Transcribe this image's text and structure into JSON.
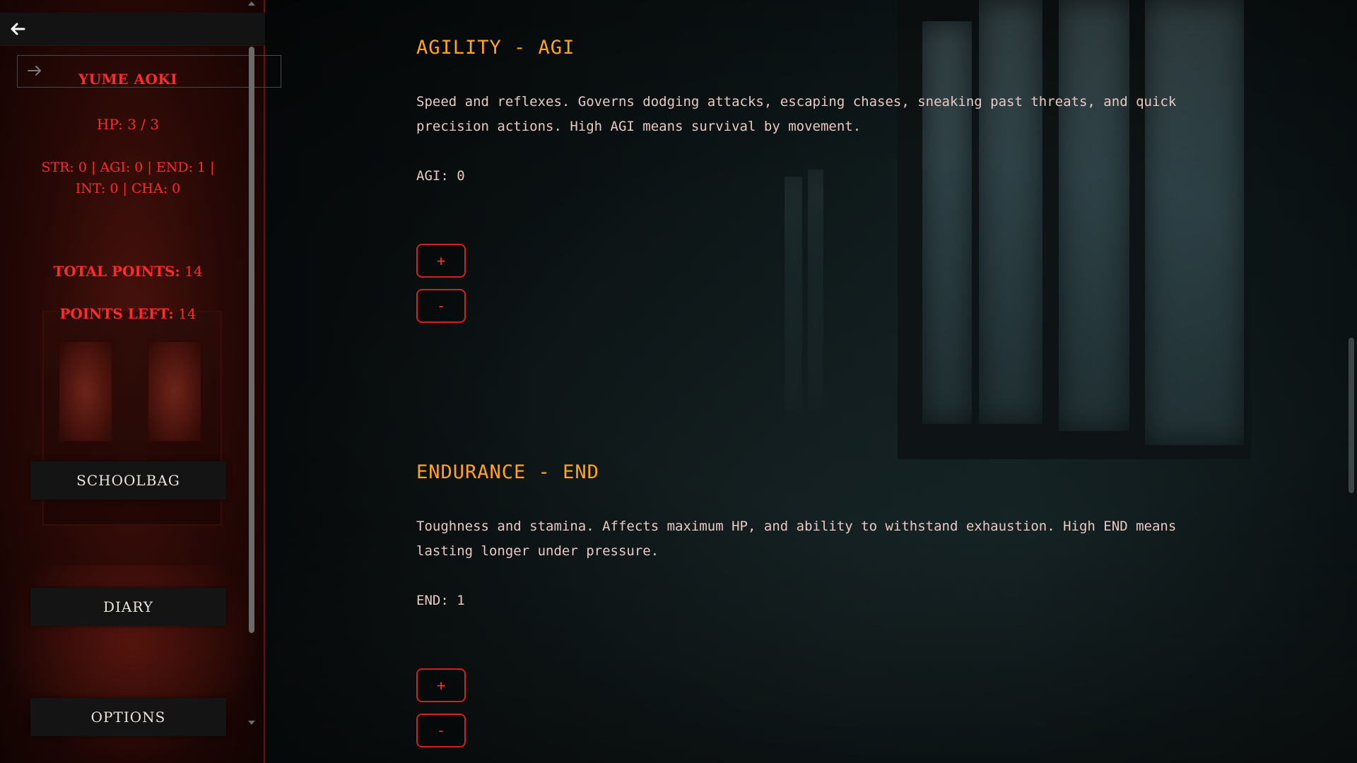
{
  "character": {
    "name": "YUME AOKI",
    "hp": "HP: 3 / 3",
    "stats_line1": "STR: 0 | AGI: 0 | END: 1 |",
    "stats_line2": "INT: 0 | CHA: 0",
    "total_points_label": "TOTAL POINTS:",
    "total_points_value": "14",
    "points_left_label": "POINTS LEFT:",
    "points_left_value": "14"
  },
  "menu": {
    "schoolbag": "SCHOOLBAG",
    "diary": "DIARY",
    "options": "OPTIONS"
  },
  "sections": {
    "agility": {
      "title": "AGILITY - AGI",
      "description": "Speed and reflexes. Governs dodging attacks, escaping chases, sneaking past threats, and quick precision actions. High AGI means survival by movement.",
      "value_line": "AGI: 0",
      "plus": "+",
      "minus": "-"
    },
    "endurance": {
      "title": "ENDURANCE - END",
      "description": "Toughness and stamina. Affects maximum HP, and ability to withstand exhaustion. High END means lasting longer under pressure.",
      "value_line": "END: 1",
      "plus": "+",
      "minus": "-"
    }
  },
  "icons": {
    "back": "arrow-left-icon",
    "profile": "arrow-right-icon"
  },
  "colors": {
    "accent_red": "#ff2b2b",
    "title_orange": "#ffa41c",
    "body_text": "#e8c9c4",
    "menu_bg": "#151415"
  }
}
